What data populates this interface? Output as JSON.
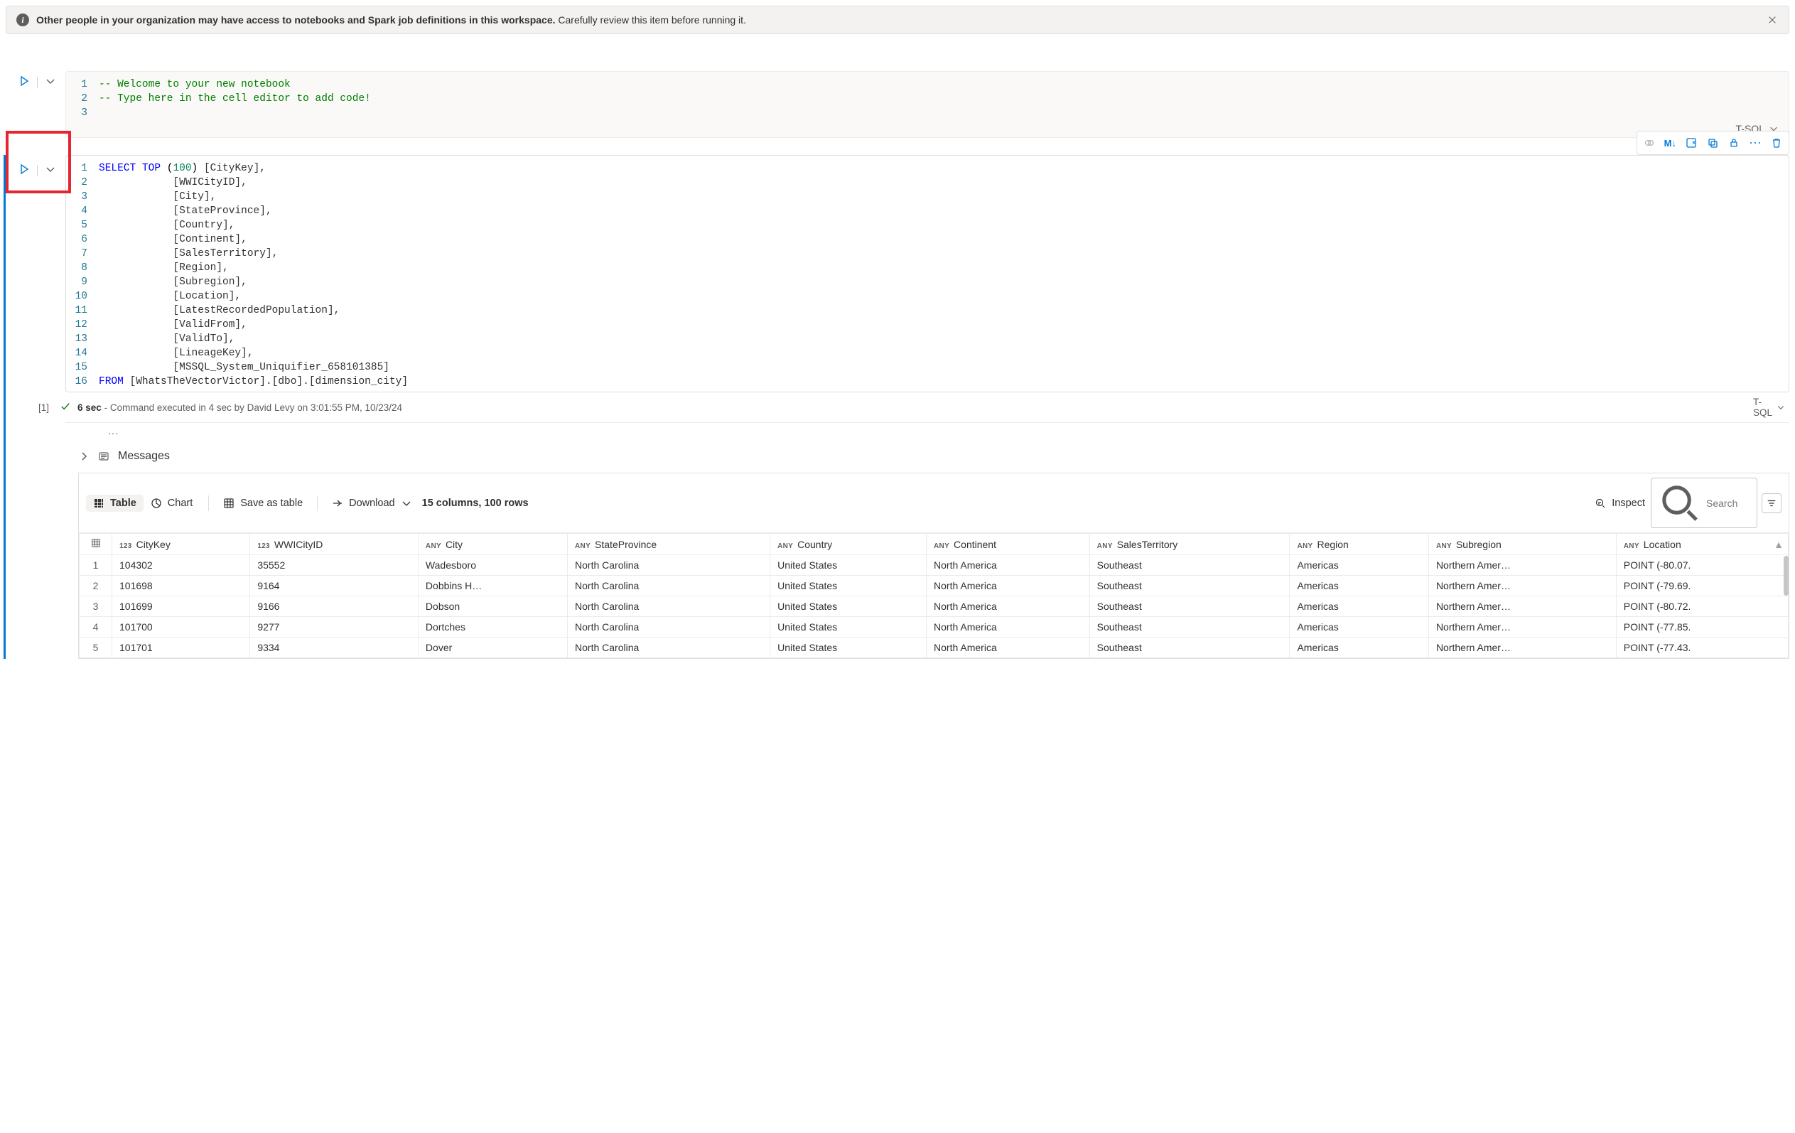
{
  "notice": {
    "bold": "Other people in your organization may have access to notebooks and Spark job definitions in this workspace.",
    "rest": " Carefully review this item before running it."
  },
  "cell1": {
    "language": "T-SQL",
    "lines": [
      "1",
      "2",
      "3"
    ],
    "code_html": "<span class='tok-comment'>-- Welcome to your new notebook</span>\n<span class='tok-comment'>-- Type here in the cell editor to add code!</span>\n"
  },
  "cell2": {
    "language": "T-SQL",
    "toolbar": {
      "markdown": "M↓"
    },
    "lines": [
      "1",
      "2",
      "3",
      "4",
      "5",
      "6",
      "7",
      "8",
      "9",
      "10",
      "11",
      "12",
      "13",
      "14",
      "15",
      "16"
    ],
    "code_html": "<span class='tok-kw'>SELECT</span> <span class='tok-kw'>TOP</span> <span class='tok-punc'>(</span><span class='tok-num'>100</span><span class='tok-punc'>)</span> [CityKey],\n            [WWICityID],\n            [City],\n            [StateProvince],\n            [Country],\n            [Continent],\n            [SalesTerritory],\n            [Region],\n            [Subregion],\n            [Location],\n            [LatestRecordedPopulation],\n            [ValidFrom],\n            [ValidTo],\n            [LineageKey],\n            [MSSQL_System_Uniquifier_658101385]\n<span class='tok-kw'>FROM</span> [WhatsTheVectorVictor].[dbo].[dimension_city]",
    "status": {
      "index": "[1]",
      "duration": "6 sec",
      "detail": "- Command executed in 4 sec by David Levy on 3:01:55 PM, 10/23/24"
    },
    "messages_label": "Messages",
    "results": {
      "tabs": {
        "table": "Table",
        "chart": "Chart"
      },
      "save": "Save as table",
      "download": "Download",
      "summary": "15 columns, 100 rows",
      "inspect": "Inspect",
      "search_placeholder": "Search",
      "columns": [
        {
          "type": "123",
          "name": "CityKey"
        },
        {
          "type": "123",
          "name": "WWICityID"
        },
        {
          "type": "ANY",
          "name": "City"
        },
        {
          "type": "ANY",
          "name": "StateProvince"
        },
        {
          "type": "ANY",
          "name": "Country"
        },
        {
          "type": "ANY",
          "name": "Continent"
        },
        {
          "type": "ANY",
          "name": "SalesTerritory"
        },
        {
          "type": "ANY",
          "name": "Region"
        },
        {
          "type": "ANY",
          "name": "Subregion"
        },
        {
          "type": "ANY",
          "name": "Location"
        }
      ],
      "rows": [
        {
          "n": "1",
          "CityKey": "104302",
          "WWICityID": "35552",
          "City": "Wadesboro",
          "StateProvince": "North Carolina",
          "Country": "United States",
          "Continent": "North America",
          "SalesTerritory": "Southeast",
          "Region": "Americas",
          "Subregion": "Northern Amer…",
          "Location": "POINT (-80.07."
        },
        {
          "n": "2",
          "CityKey": "101698",
          "WWICityID": "9164",
          "City": "Dobbins H…",
          "StateProvince": "North Carolina",
          "Country": "United States",
          "Continent": "North America",
          "SalesTerritory": "Southeast",
          "Region": "Americas",
          "Subregion": "Northern Amer…",
          "Location": "POINT (-79.69."
        },
        {
          "n": "3",
          "CityKey": "101699",
          "WWICityID": "9166",
          "City": "Dobson",
          "StateProvince": "North Carolina",
          "Country": "United States",
          "Continent": "North America",
          "SalesTerritory": "Southeast",
          "Region": "Americas",
          "Subregion": "Northern Amer…",
          "Location": "POINT (-80.72."
        },
        {
          "n": "4",
          "CityKey": "101700",
          "WWICityID": "9277",
          "City": "Dortches",
          "StateProvince": "North Carolina",
          "Country": "United States",
          "Continent": "North America",
          "SalesTerritory": "Southeast",
          "Region": "Americas",
          "Subregion": "Northern Amer…",
          "Location": "POINT (-77.85."
        },
        {
          "n": "5",
          "CityKey": "101701",
          "WWICityID": "9334",
          "City": "Dover",
          "StateProvince": "North Carolina",
          "Country": "United States",
          "Continent": "North America",
          "SalesTerritory": "Southeast",
          "Region": "Americas",
          "Subregion": "Northern Amer…",
          "Location": "POINT (-77.43."
        }
      ]
    }
  }
}
